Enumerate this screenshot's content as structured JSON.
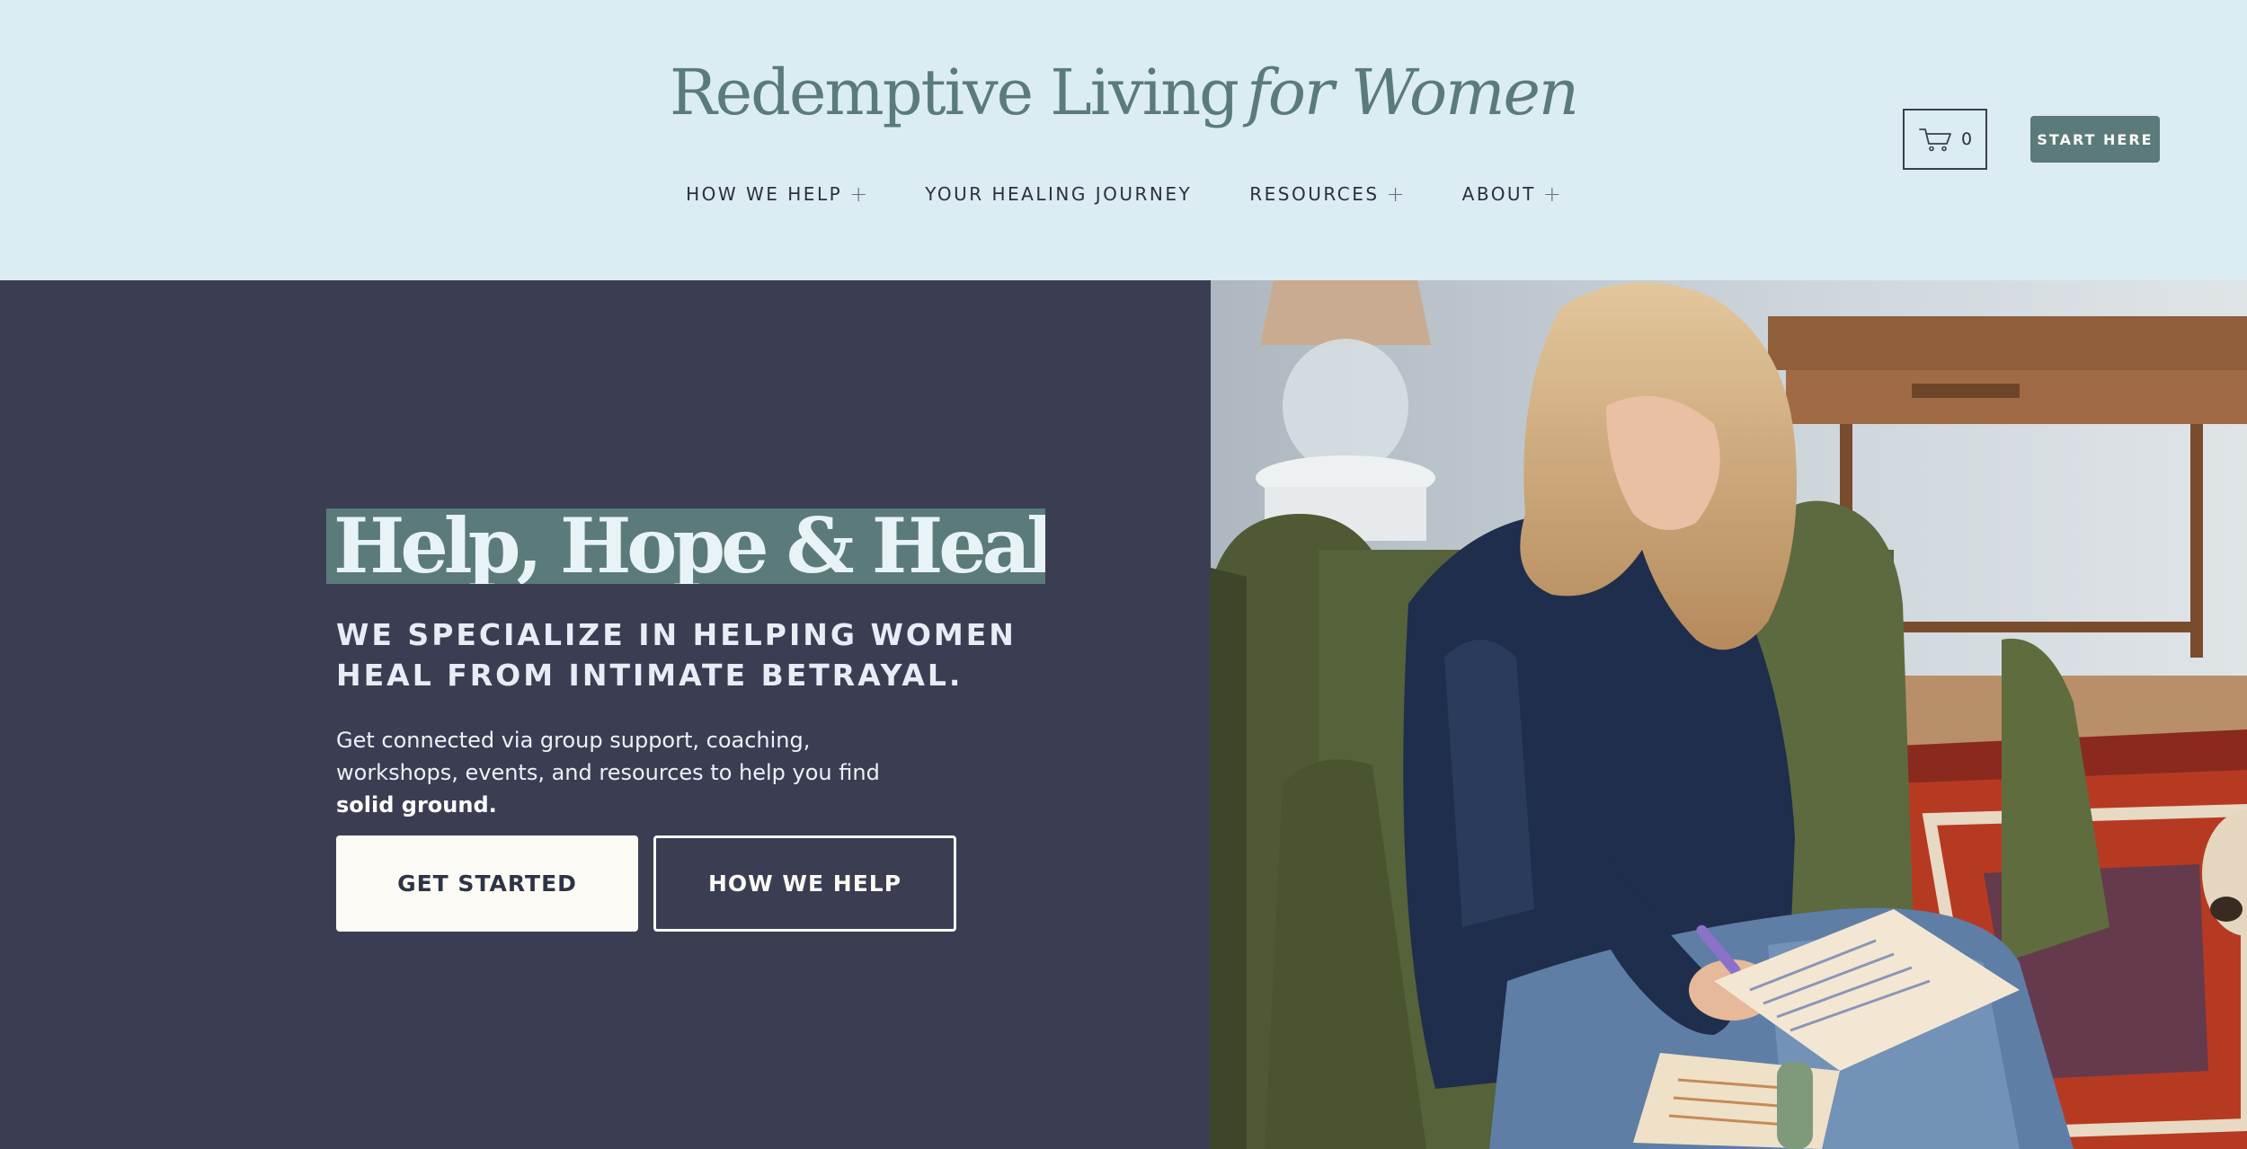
{
  "header": {
    "logo_main": "Redemptive Living",
    "logo_script": "for Women",
    "nav": [
      {
        "label": "HOW WE HELP",
        "expandable": true
      },
      {
        "label": "YOUR HEALING JOURNEY",
        "expandable": false
      },
      {
        "label": "RESOURCES",
        "expandable": true
      },
      {
        "label": "ABOUT",
        "expandable": true
      }
    ],
    "nav_plus": "+",
    "cart_count": "0",
    "cta_label": "START HERE",
    "colors": {
      "background": "#dbecf3",
      "accent": "#5b7b7a"
    }
  },
  "hero": {
    "title": "Help, Hope & Healing.",
    "subtitle": "WE SPECIALIZE IN HELPING WOMEN HEAL FROM INTIMATE BETRAYAL.",
    "body": "Get connected via group support, coaching, workshops, events, and resources to help you find",
    "body_bold": "solid ground.",
    "primary_button": "GET STARTED",
    "secondary_button": "HOW WE HELP",
    "colors": {
      "background": "#3b3e53",
      "title_highlight": "#5b7b7a",
      "button_light": "#fbfaf5"
    }
  },
  "photo": {
    "icon": "woman-writing-in-journal-photo"
  }
}
